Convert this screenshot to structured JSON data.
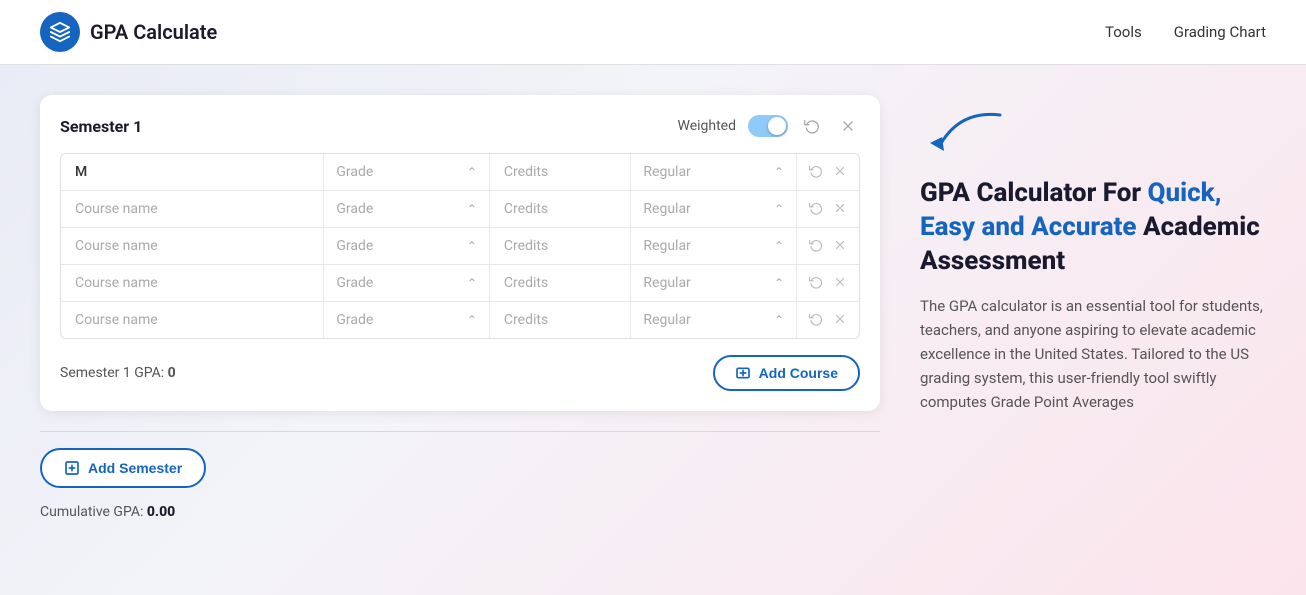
{
  "header": {
    "logo_text": "GPA Calculate",
    "nav_items": [
      "Tools",
      "Grading Chart"
    ]
  },
  "semester": {
    "title": "Semester 1",
    "weighted_label": "Weighted",
    "gpa_label": "Semester 1 GPA:",
    "gpa_value": "0",
    "add_course_label": "Add Course",
    "add_semester_label": "Add Semester",
    "cumulative_label": "Cumulative GPA:",
    "cumulative_value": "0.00"
  },
  "courses": [
    {
      "name": "M",
      "has_value": true,
      "grade": "Grade",
      "credits": "Credits",
      "type": "Regular"
    },
    {
      "name": "Course name",
      "has_value": false,
      "grade": "Grade",
      "credits": "Credits",
      "type": "Regular"
    },
    {
      "name": "Course name",
      "has_value": false,
      "grade": "Grade",
      "credits": "Credits",
      "type": "Regular"
    },
    {
      "name": "Course name",
      "has_value": false,
      "grade": "Grade",
      "credits": "Credits",
      "type": "Regular"
    },
    {
      "name": "Course name",
      "has_value": false,
      "grade": "Grade",
      "credits": "Credits",
      "type": "Regular"
    }
  ],
  "right_panel": {
    "heading_part1": "GPA Calculator For ",
    "heading_highlight": "Quick, Easy and Accurate",
    "heading_part2": " Academic Assessment",
    "description": "The GPA calculator is an essential tool for students, teachers, and anyone aspiring to elevate academic excellence in the United States. Tailored to the US grading system, this user-friendly tool swiftly computes Grade Point Averages"
  }
}
